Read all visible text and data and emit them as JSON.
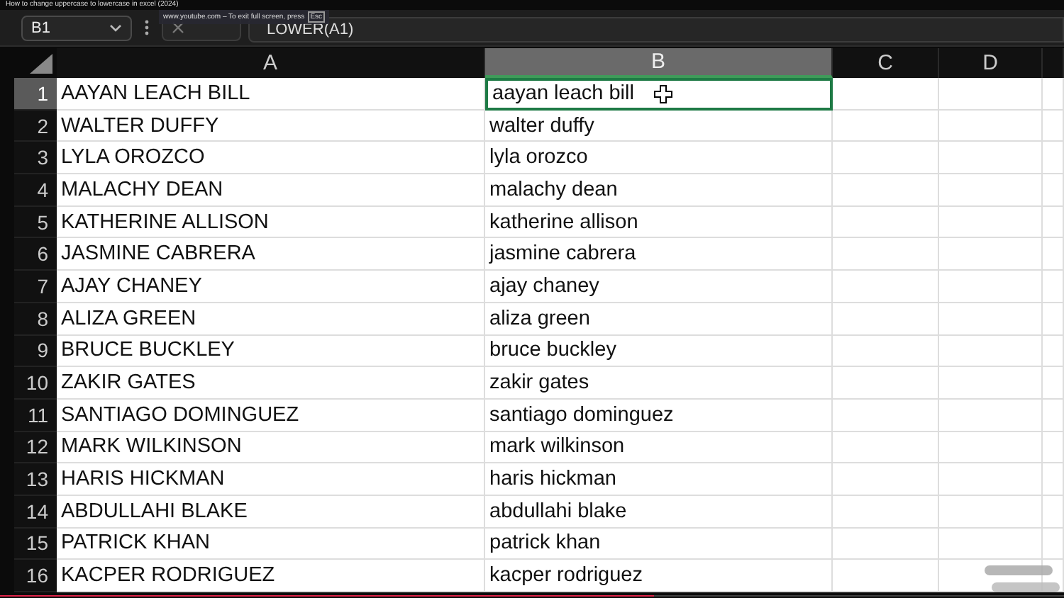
{
  "video_title": "How to change uppercase to lowercase in excel (2024)",
  "name_box": "B1",
  "formula": "LOWER(A1)",
  "fullscreen_tip": {
    "text": "www.youtube.com – To exit full screen, press",
    "key": "Esc"
  },
  "columns": [
    {
      "label": "A",
      "selected": false
    },
    {
      "label": "B",
      "selected": true
    },
    {
      "label": "C",
      "selected": false
    },
    {
      "label": "D",
      "selected": false
    }
  ],
  "rows": [
    {
      "number": "1",
      "selected": true,
      "cells": [
        "AAYAN LEACH BILL",
        "aayan leach bill"
      ]
    },
    {
      "number": "2",
      "selected": false,
      "cells": [
        "WALTER DUFFY",
        "walter duffy"
      ]
    },
    {
      "number": "3",
      "selected": false,
      "cells": [
        "LYLA OROZCO",
        "lyla orozco"
      ]
    },
    {
      "number": "4",
      "selected": false,
      "cells": [
        "MALACHY DEAN",
        "malachy dean"
      ]
    },
    {
      "number": "5",
      "selected": false,
      "cells": [
        "KATHERINE ALLISON",
        "katherine allison"
      ]
    },
    {
      "number": "6",
      "selected": false,
      "cells": [
        "JASMINE CABRERA",
        "jasmine cabrera"
      ]
    },
    {
      "number": "7",
      "selected": false,
      "cells": [
        "AJAY CHANEY",
        "ajay chaney"
      ]
    },
    {
      "number": "8",
      "selected": false,
      "cells": [
        "ALIZA GREEN",
        "aliza green"
      ]
    },
    {
      "number": "9",
      "selected": false,
      "cells": [
        "BRUCE BUCKLEY",
        "bruce buckley"
      ]
    },
    {
      "number": "10",
      "selected": false,
      "cells": [
        "ZAKIR GATES",
        "zakir gates"
      ]
    },
    {
      "number": "11",
      "selected": false,
      "cells": [
        "SANTIAGO DOMINGUEZ",
        "santiago dominguez"
      ]
    },
    {
      "number": "12",
      "selected": false,
      "cells": [
        "MARK WILKINSON",
        "mark wilkinson"
      ]
    },
    {
      "number": "13",
      "selected": false,
      "cells": [
        "HARIS HICKMAN",
        "haris hickman"
      ]
    },
    {
      "number": "14",
      "selected": false,
      "cells": [
        "ABDULLAHI BLAKE",
        "abdullahi blake"
      ]
    },
    {
      "number": "15",
      "selected": false,
      "cells": [
        "PATRICK KHAN",
        "patrick khan"
      ]
    },
    {
      "number": "16",
      "selected": false,
      "cells": [
        "KACPER RODRIGUEZ",
        "kacper rodriguez"
      ]
    }
  ],
  "progress": {
    "level": 0.615
  }
}
